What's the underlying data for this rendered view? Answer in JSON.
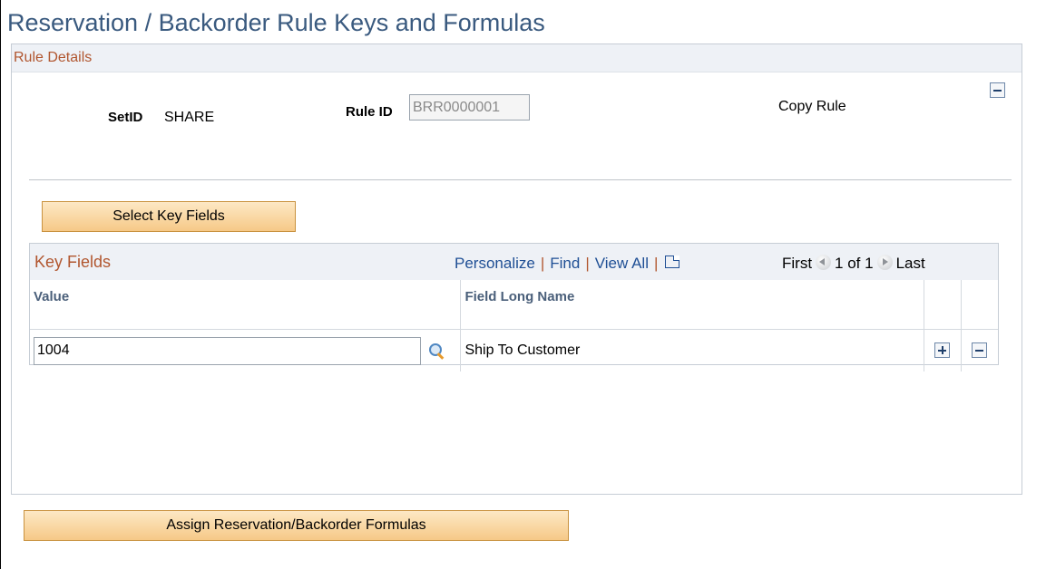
{
  "page": {
    "title": "Reservation / Backorder Rule Keys and Formulas"
  },
  "rule_details": {
    "header": "Rule Details",
    "setid_label": "SetID",
    "setid_value": "SHARE",
    "ruleid_label": "Rule ID",
    "ruleid_value": "BRR0000001",
    "copy_rule": "Copy Rule",
    "select_key_fields_button": "Select Key Fields"
  },
  "key_fields": {
    "title": "Key Fields",
    "nav": {
      "personalize": "Personalize",
      "find": "Find",
      "view_all": "View All",
      "first": "First",
      "range": "1 of 1",
      "last": "Last"
    },
    "columns": [
      "Value",
      "Field Long Name"
    ],
    "rows": [
      {
        "value": "1004",
        "field_long_name": "Ship To Customer"
      }
    ]
  },
  "footer": {
    "assign_button": "Assign Reservation/Backorder Formulas"
  },
  "colors": {
    "title": "#3a5a7f",
    "section_header": "#b1562f",
    "link": "#1f4f95",
    "button_top": "#fde8c5",
    "button_bottom": "#f6c987"
  }
}
